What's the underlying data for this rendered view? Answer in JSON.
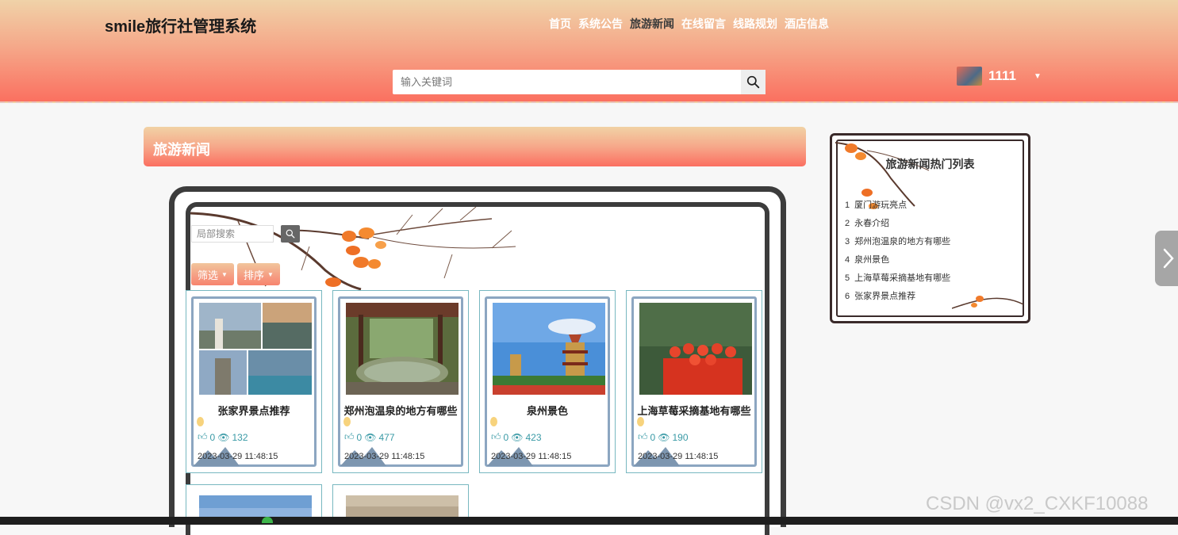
{
  "app": {
    "title": "smile旅行社管理系统"
  },
  "nav": {
    "items": [
      {
        "label": "首页",
        "active": false
      },
      {
        "label": "系统公告",
        "active": false
      },
      {
        "label": "旅游新闻",
        "active": true
      },
      {
        "label": "在线留言",
        "active": false
      },
      {
        "label": "线路规划",
        "active": false
      },
      {
        "label": "酒店信息",
        "active": false
      }
    ]
  },
  "search": {
    "placeholder": "输入关键词",
    "value": ""
  },
  "user": {
    "name": "1111"
  },
  "section": {
    "title": "旅游新闻"
  },
  "filter": {
    "search_placeholder": "局部搜索",
    "filter_label": "筛选",
    "sort_label": "排序"
  },
  "cards": [
    {
      "title": "张家界景点推荐",
      "likes": "0",
      "views": "132",
      "date": "2023-03-29 11:48:15"
    },
    {
      "title": "郑州泡温泉的地方有哪些",
      "likes": "0",
      "views": "477",
      "date": "2023-03-29 11:48:15"
    },
    {
      "title": "泉州景色",
      "likes": "0",
      "views": "423",
      "date": "2023-03-29 11:48:15"
    },
    {
      "title": "上海草莓采摘基地有哪些",
      "likes": "0",
      "views": "190",
      "date": "2023-03-29 11:48:15"
    }
  ],
  "hot": {
    "title": "旅游新闻热门列表",
    "items": [
      {
        "rank": "1",
        "label": "厦门游玩亮点"
      },
      {
        "rank": "2",
        "label": "永春介绍"
      },
      {
        "rank": "3",
        "label": "郑州泡温泉的地方有哪些"
      },
      {
        "rank": "4",
        "label": "泉州景色"
      },
      {
        "rank": "5",
        "label": "上海草莓采摘基地有哪些"
      },
      {
        "rank": "6",
        "label": "张家界景点推荐"
      }
    ]
  },
  "watermark": {
    "text": "CSDN @vx2_CXKF10088"
  },
  "icons": {
    "search": "search-icon",
    "eye": "eye-icon",
    "like": "thumb-up-icon",
    "arrow": "chevron-right-icon"
  }
}
